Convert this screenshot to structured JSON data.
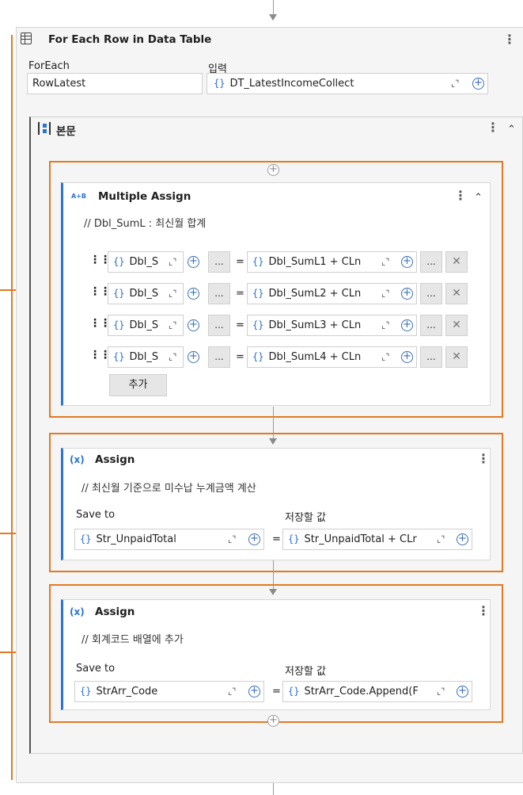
{
  "foreach": {
    "title": "For Each Row in Data Table",
    "foreach_label": "ForEach",
    "foreach_value": "RowLatest",
    "input_label": "입력",
    "input_value": "DT_LatestIncomeCollect"
  },
  "body_scope": {
    "title": "본문"
  },
  "multiple_assign": {
    "icon_text": "A+B",
    "title": "Multiple Assign",
    "comment": "// Dbl_SumL : 최신월 합계",
    "rows": [
      {
        "left": "Dbl_S",
        "right": "Dbl_SumL1 + CLn"
      },
      {
        "left": "Dbl_S",
        "right": "Dbl_SumL2 + CLn"
      },
      {
        "left": "Dbl_S",
        "right": "Dbl_SumL3 + CLn"
      },
      {
        "left": "Dbl_S",
        "right": "Dbl_SumL4 + CLn"
      }
    ],
    "ellipsis": "...",
    "add_label": "추가"
  },
  "assign1": {
    "icon_text": "(x)",
    "title": "Assign",
    "comment": "// 최신월 기준으로 미수납 누계금액 계산",
    "save_to_label": "Save to",
    "value_label": "저장할 값",
    "save_to_value": "Str_UnpaidTotal",
    "value_value": "Str_UnpaidTotal + CLr"
  },
  "assign2": {
    "icon_text": "(x)",
    "title": "Assign",
    "comment": "// 회계코드 배열에 추가",
    "save_to_label": "Save to",
    "value_label": "저장할 값",
    "save_to_value": "StrArr_Code",
    "value_value": "StrArr_Code.Append(F"
  },
  "symbols": {
    "brace": "{}",
    "equals": "=",
    "kebab": "⋮",
    "plus": "+",
    "expand": "⌞⌝",
    "close": "✕",
    "collapse": "⌃"
  },
  "colors": {
    "accent": "#2b74d0",
    "highlight": "#e07a22",
    "card_bg": "#f5f5f5"
  }
}
